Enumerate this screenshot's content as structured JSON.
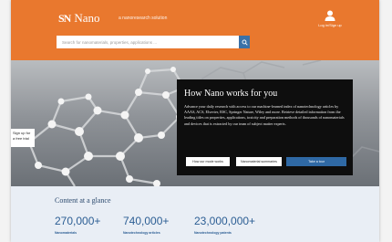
{
  "header": {
    "logo_mark": "SN",
    "logo_text": "Nano",
    "tagline": "a nanoresearch solution",
    "account_label": "Log in/Sign up"
  },
  "search": {
    "placeholder": "Search for nanomaterials, properties, applications ..."
  },
  "hero": {
    "signup_text": "Sign up for a free trial"
  },
  "panel": {
    "title": "How Nano works for you",
    "body": "Advance your daily research with access to our machine-learned index of nanotechnology articles by AAAS, ACS, Elsevier, RSC, Springer Nature, Wiley and more. Retrieve detailed information from the leading titles on properties, applications, toxicity and preparation methods of thousands of nanomaterials and devices that is extracted by our team of subject matter experts.",
    "buttons": [
      "How our mode works",
      "Nanomaterial summaries",
      "Take a tour"
    ]
  },
  "glance": {
    "title": "Content at a glance",
    "stats": [
      {
        "value": "270,000+",
        "label": "Nanomaterials"
      },
      {
        "value": "740,000+",
        "label": "Nanotechnology articles"
      },
      {
        "value": "23,000,000+",
        "label": "Nanotechnology patents"
      }
    ]
  },
  "colors": {
    "header": "#e9782e",
    "search_button": "#3a71a8",
    "panel": "#0e0e0e",
    "primary_button": "#2f69a5",
    "glance_bg": "#e9eef5",
    "stat_text": "#2c5e94"
  },
  "icons": {
    "account": "user-icon",
    "search": "search-icon"
  }
}
